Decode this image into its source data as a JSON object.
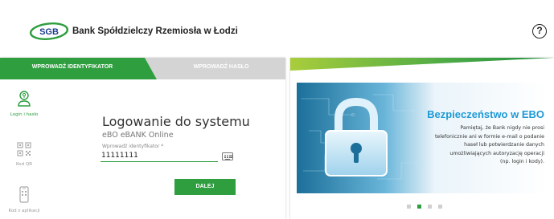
{
  "header": {
    "logo_text": "SGB",
    "bank_name": "Bank Spółdzielczy Rzemiosła w Łodzi",
    "help_icon": "?"
  },
  "tabs": [
    {
      "label": "WPROWADŹ IDENTYFIKATOR",
      "active": true
    },
    {
      "label": "WPROWADŹ HASŁO",
      "active": false
    }
  ],
  "methods": [
    {
      "icon": "user-key-icon",
      "label": "Login i hasło",
      "active": true
    },
    {
      "icon": "qr-code-icon",
      "label": "Kod QR",
      "active": false
    },
    {
      "icon": "mobile-app-icon",
      "label": "Kod z aplikacji",
      "active": false
    }
  ],
  "form": {
    "title": "Logowanie do systemu",
    "subtitle": "eBO eBANK Online",
    "field_label": "Wprowadź identyfikator *",
    "field_value": "11111111",
    "next_label": "DALEJ"
  },
  "promo": {
    "title": "Bezpieczeństwo w EBO",
    "text_lines": [
      "Pamiętaj, że Bank nigdy nie prosi",
      "telefonicznie ani w formie e-mail o podanie",
      "haseł lub potwierdzanie danych",
      "umożliwiających autoryzację operacji",
      "(np. login i kody)."
    ],
    "slide_count": 4,
    "active_slide": 2
  },
  "colors": {
    "brand_green": "#2e9e3f",
    "inactive_tab": "#d4d4d4",
    "promo_blue": "#1e9ad6"
  }
}
